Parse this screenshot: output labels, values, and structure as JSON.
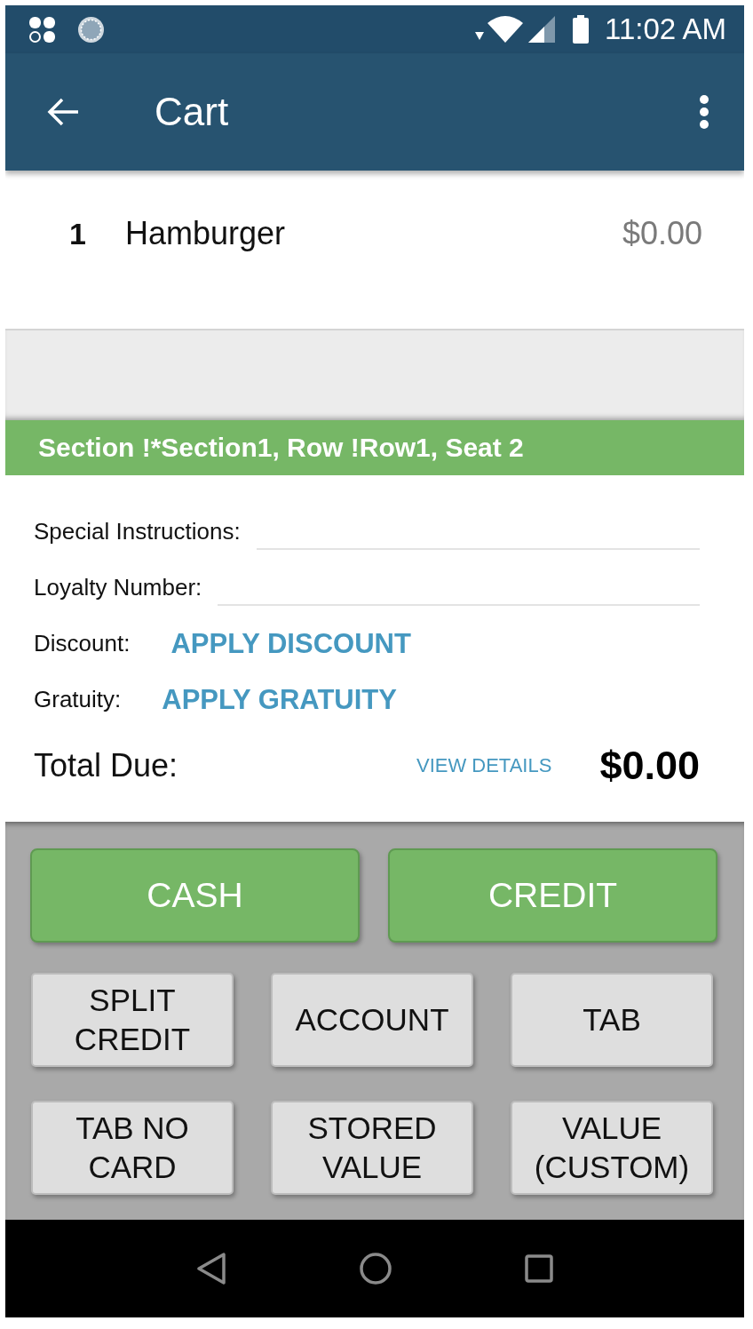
{
  "status_bar": {
    "time": "11:02 AM"
  },
  "app_bar": {
    "title": "Cart"
  },
  "cart_items": [
    {
      "quantity": "1",
      "name": "Hamburger",
      "price": "$0.00"
    }
  ],
  "seat_banner": {
    "text": "Section !*Section1, Row !Row1, Seat 2"
  },
  "order_fields": [
    {
      "kind": "input",
      "label": "Special Instructions:"
    },
    {
      "kind": "input",
      "label": "Loyalty Number:"
    },
    {
      "kind": "action",
      "label": "Discount:",
      "action": "APPLY DISCOUNT"
    },
    {
      "kind": "action",
      "label": "Gratuity:",
      "action": "APPLY GRATUITY"
    }
  ],
  "total": {
    "label": "Total Due:",
    "link": "VIEW DETAILS",
    "amount": "$0.00"
  },
  "payment_buttons": [
    {
      "kind": "primary",
      "label": "CASH"
    },
    {
      "kind": "primary",
      "label": "CREDIT"
    },
    {
      "kind": "secondary",
      "label": "SPLIT CREDIT"
    },
    {
      "kind": "secondary",
      "label": "ACCOUNT"
    },
    {
      "kind": "secondary",
      "label": "TAB"
    },
    {
      "kind": "secondary",
      "label": "TAB NO CARD"
    },
    {
      "kind": "secondary",
      "label": "STORED VALUE"
    },
    {
      "kind": "secondary",
      "label": "VALUE (CUSTOM)"
    }
  ]
}
